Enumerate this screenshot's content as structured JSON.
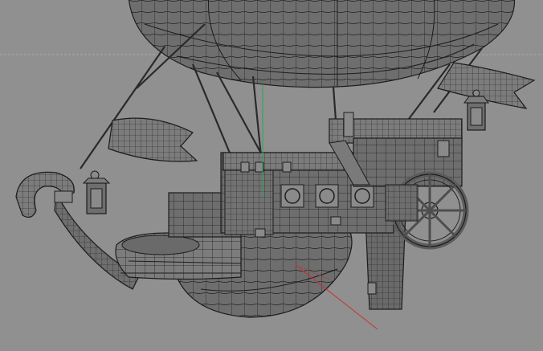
{
  "viewport": {
    "background": "#909090",
    "mesh_fill": "#6e6e6e",
    "mesh_fill_light": "#7c7c7c",
    "wire_color": "#1c1c1c",
    "grid_color": "#a8a8a8",
    "axis_x_color": "#c83232",
    "axis_y_color": "#2aa84a"
  },
  "scene": {
    "model": "airship-wireframe-mesh",
    "parts": [
      "balloon",
      "hull",
      "cabin",
      "deck-railing",
      "bow-figurehead",
      "flags",
      "lanterns",
      "steering-wheel",
      "propeller",
      "rigging-ropes",
      "transform-gizmo"
    ]
  }
}
